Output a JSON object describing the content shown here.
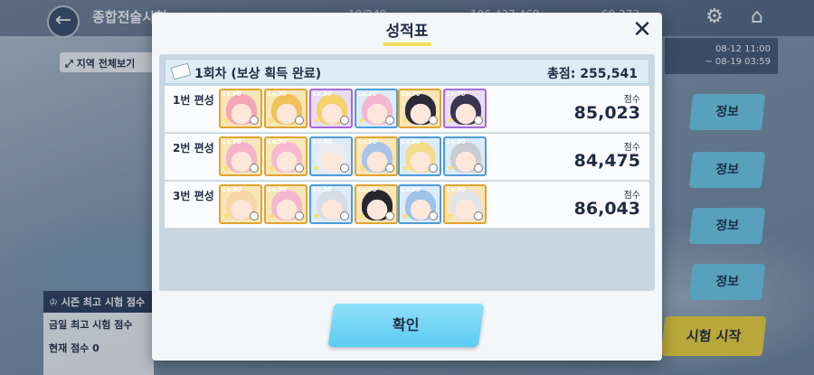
{
  "background": {
    "title": "종합전술시험",
    "resources": [
      "10/240",
      "106,437,468",
      "69,273"
    ],
    "region_button": "지역 전체보기",
    "dates": [
      "08-12 11:00",
      "~ 08-19 03:59"
    ],
    "info_buttons": [
      "정보",
      "정보",
      "정보",
      "정보"
    ],
    "season": {
      "header": "시즌 최고 시험 점수",
      "today_label": "금일 최고 시험 점수",
      "current_label": "현재 점수",
      "current_value": "0"
    },
    "start_button": "시험 시작"
  },
  "modal": {
    "title": "성적표",
    "round_title": "1회차 (보상 획득 완료)",
    "total_score": "총점: 255,541",
    "score_label": "점수",
    "teams": [
      {
        "label": "1번 편성",
        "score": "85,023",
        "slots": [
          {
            "border": "gold",
            "hair": "#f2a6b6",
            "level": "Lv.90"
          },
          {
            "border": "gold",
            "hair": "#f0c05a",
            "level": "Lv.90"
          },
          {
            "border": "purple",
            "hair": "#f3d36a",
            "level": "Lv.90"
          },
          {
            "border": "blue",
            "hair": "#f3b7d0",
            "level": "Lv.90"
          },
          {
            "border": "gold",
            "hair": "#2b2b3a",
            "level": "Lv.90"
          },
          {
            "border": "purple",
            "hair": "#3a3550",
            "level": "Lv.90"
          }
        ]
      },
      {
        "label": "2번 편성",
        "score": "84,475",
        "slots": [
          {
            "border": "gold",
            "hair": "#f4b4c8",
            "level": "Lv.90"
          },
          {
            "border": "gold",
            "hair": "#f7b9d0",
            "level": "Lv.90"
          },
          {
            "border": "blue",
            "hair": "#ececf0",
            "level": "Lv.90"
          },
          {
            "border": "gold",
            "hair": "#a9c4e8",
            "level": "Lv.90"
          },
          {
            "border": "blue",
            "hair": "#f4dd8a",
            "level": "Lv.90"
          },
          {
            "border": "blue",
            "hair": "#c9ccd3",
            "level": "Lv.90"
          }
        ]
      },
      {
        "label": "3번 편성",
        "score": "86,043",
        "slots": [
          {
            "border": "gold",
            "hair": "#f6d6a8",
            "level": "Lv.90"
          },
          {
            "border": "gold",
            "hair": "#f4b9cf",
            "level": "Lv.90"
          },
          {
            "border": "blue",
            "hair": "#d8dce6",
            "level": "Lv.90"
          },
          {
            "border": "gold",
            "hair": "#26242e",
            "level": "Lv.90"
          },
          {
            "border": "blue",
            "hair": "#9ec3ea",
            "level": "Lv.90"
          },
          {
            "border": "gold",
            "hair": "#e3e3ea",
            "level": "Lv.90"
          }
        ]
      }
    ],
    "confirm_button": "확인"
  },
  "colors": {
    "accent": "#5ccbf1",
    "title_underline": "#f2e05a",
    "start_button": "#f5d83a"
  }
}
